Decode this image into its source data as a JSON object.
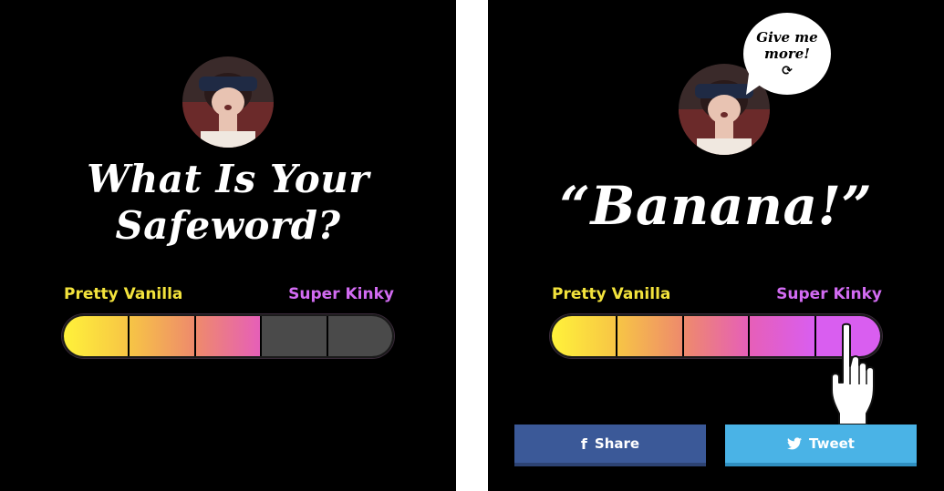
{
  "left_panel": {
    "title_line1": "What Is Your",
    "title_line2": "Safeword?",
    "scale": {
      "low_label": "Pretty Vanilla",
      "high_label": "Super Kinky",
      "total_segments": 5,
      "filled_segments": 3
    }
  },
  "right_panel": {
    "answer": "“Banana!”",
    "bubble": {
      "line1": "Give me",
      "line2": "more!",
      "icon": "refresh-icon"
    },
    "scale": {
      "low_label": "Pretty Vanilla",
      "high_label": "Super Kinky",
      "total_segments": 5,
      "filled_segments": 5
    },
    "share_label": "Share",
    "tweet_label": "Tweet"
  },
  "colors": {
    "background": "#000000",
    "vanilla": "#f3e33c",
    "kinky": "#d26bf2",
    "empty_segment": "#4a4a4a",
    "facebook": "#3b5998",
    "twitter": "#4ab3e6",
    "gradient": [
      "#fff23a",
      "#f7c545",
      "#ee8a6c",
      "#e65fb8",
      "#d95ef0"
    ]
  }
}
